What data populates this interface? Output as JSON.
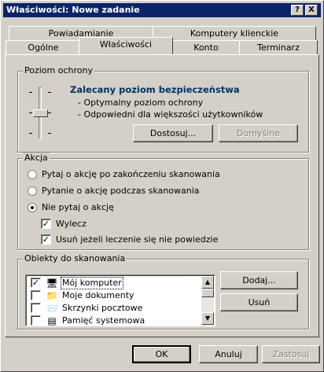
{
  "window": {
    "title": "Właściwości: Nowe zadanie",
    "help_label": "?",
    "close_label": "X"
  },
  "tabs": {
    "row1": [
      "Powiadamianie",
      "Komputery klienckie"
    ],
    "row2": [
      "Ogólne",
      "Właściwości",
      "Konto",
      "Terminarz"
    ],
    "active": "Właściwości"
  },
  "protection": {
    "group_title": "Poziom ochrony",
    "level_title": "Zalecany poziom bezpieczeństwa",
    "bullets": [
      "- Optymalny poziom ochrony",
      "- Odpowiedni dla większości użytkowników"
    ],
    "customize_label": "Dostosuj...",
    "default_label": "Domyślne",
    "slider_level": "Zalecany"
  },
  "action": {
    "group_title": "Akcja",
    "options": [
      {
        "label": "Pytaj o akcję po zakończeniu skanowania",
        "selected": false
      },
      {
        "label": "Pytanie o akcję podczas skanowania",
        "selected": false
      },
      {
        "label": "Nie pytaj o akcję",
        "selected": true
      }
    ],
    "checks": [
      {
        "label": "Wylecz",
        "checked": true
      },
      {
        "label": "Usuń jeżeli leczenie się nie powiedzie",
        "checked": true
      }
    ]
  },
  "scan_objects": {
    "group_title": "Obiekty do skanowania",
    "items": [
      {
        "label": "Mój komputer",
        "checked": true,
        "icon": "computer-icon",
        "selected": true
      },
      {
        "label": "Moje dokumenty",
        "checked": false,
        "icon": "folder-icon",
        "selected": false
      },
      {
        "label": "Skrzynki pocztowe",
        "checked": false,
        "icon": "mailbox-icon",
        "selected": false
      },
      {
        "label": "Pamięć systemowa",
        "checked": false,
        "icon": "memory-icon",
        "selected": false
      }
    ],
    "add_label": "Dodaj...",
    "remove_label": "Usuń"
  },
  "footer": {
    "ok_label": "OK",
    "cancel_label": "Anuluj",
    "apply_label": "Zastosuj"
  },
  "colors": {
    "titlebar": "#0a246a",
    "face": "#d4d0c8",
    "selection": "#0a246a",
    "level_title": "#003366"
  }
}
